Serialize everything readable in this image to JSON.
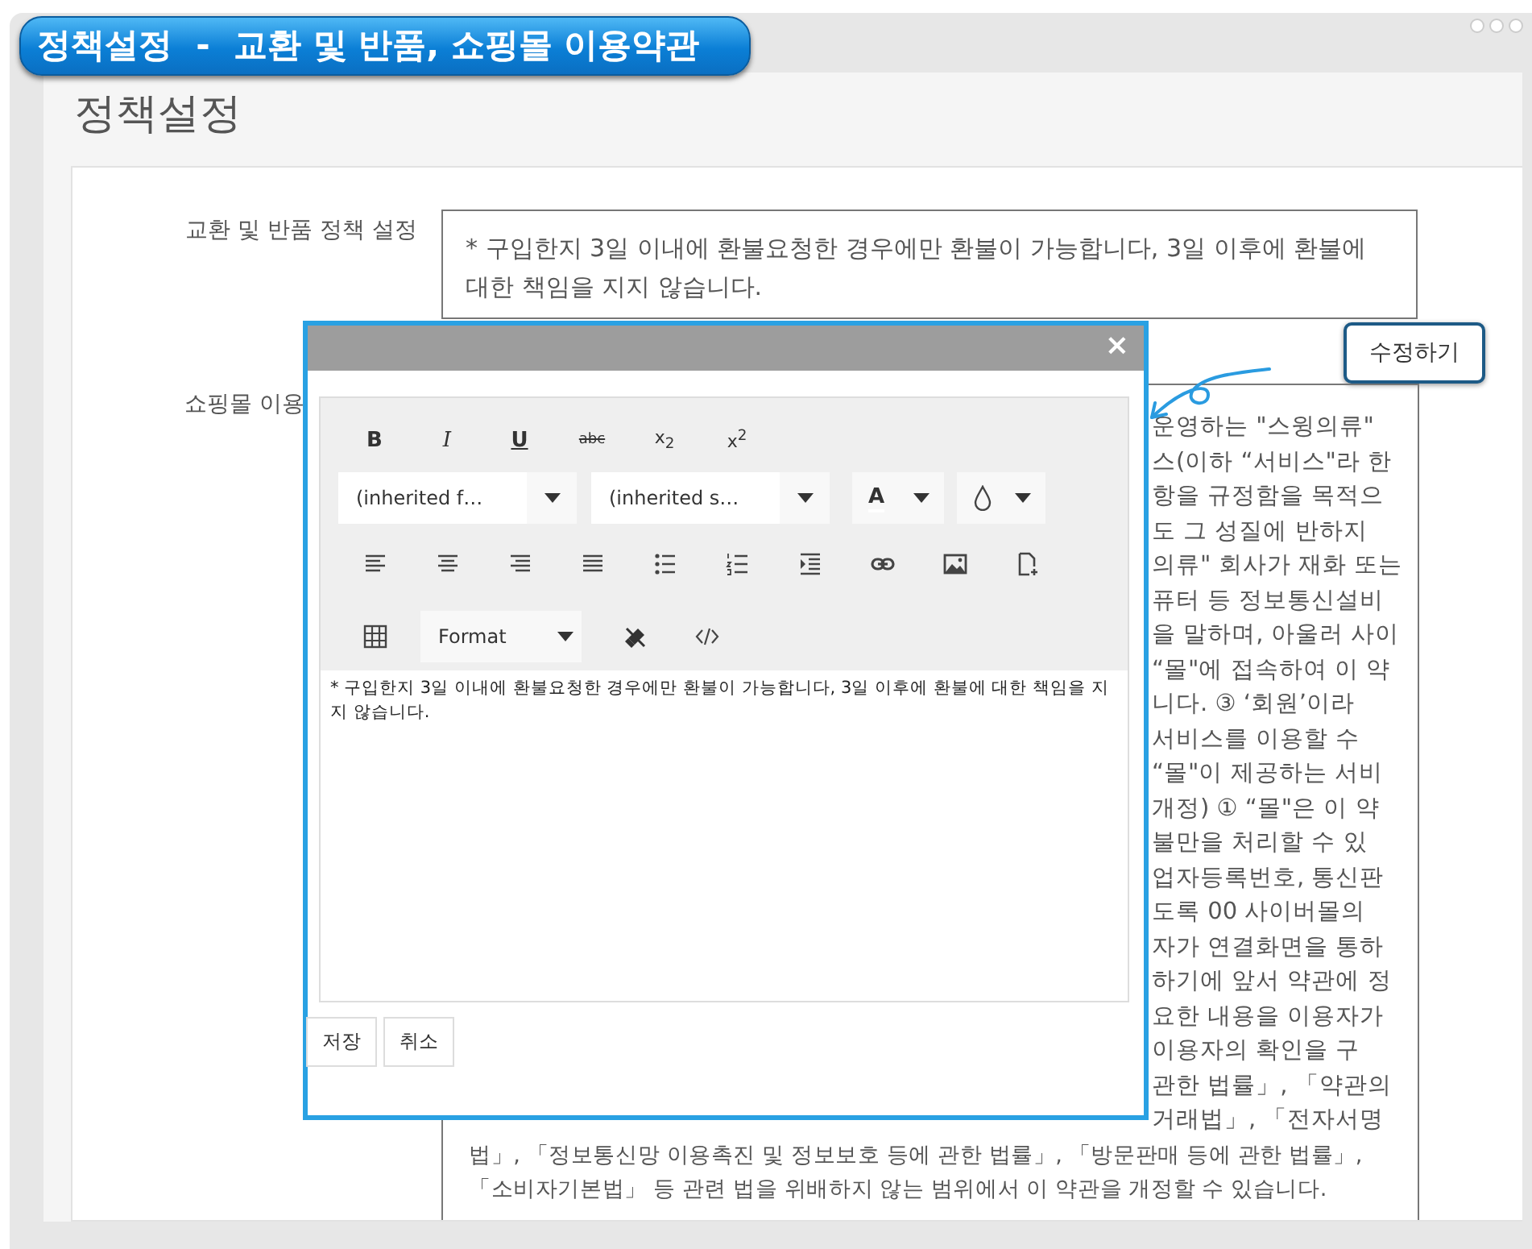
{
  "badge": {
    "title": "정책설정  -  교환 및 반품, 쇼핑몰 이용약관"
  },
  "page": {
    "heading": "정책설정"
  },
  "form": {
    "exchange_policy": {
      "label": "교환 및 반품 정책 설정",
      "value": "* 구입한지 3일 이내에 환불요청한 경우에만 환불이 가능합니다, 3일 이후에 환불에 대한 책임을 지지 않습니다."
    },
    "edit_button": "수정하기",
    "terms": {
      "label": "쇼핑몰 이용",
      "partial_lines": [
        "운영하는 \"스윙의류\"",
        "스(이하 “서비스\"라 한",
        "항을 규정함을 목적으",
        "도 그 성질에 반하지",
        "의류\" 회사가 재화 또는",
        "퓨터 등 정보통신설비",
        "을 말하며, 아울러 사이",
        "“몰\"에 접속하여 이 약",
        "니다. ③ ‘회원’이라",
        "서비스를 이용할 수",
        "“몰\"이 제공하는 서비",
        "개정) ① “몰\"은 이 약",
        "불만을 처리할 수 있",
        "업자등록번호, 통신판",
        "도록 00 사이버몰의",
        "자가 연결화면을 통하",
        "하기에 앞서 약관에 정",
        "요한 내용을 이용자가",
        "이용자의 확인을 구",
        "관한 법률」, 「약관의",
        "거래법」, 「전자서명"
      ],
      "lines": [
        "법」, 「정보통신망 이용촉진 및 정보보호 등에 관한 법률」, 「방문판매 등에 관한 법률」,",
        "「소비자기본법」 등 관련 법을 위배하지 않는 범위에서 이 약관을 개정할 수 있습니다."
      ]
    }
  },
  "modal": {
    "close": "×",
    "toolbar": [
      [
        {
          "kind": "bold",
          "label": "B"
        },
        {
          "kind": "italic",
          "label": "I"
        },
        {
          "kind": "underline",
          "label": "U"
        },
        {
          "kind": "strike",
          "label": "abc"
        },
        {
          "kind": "subscript",
          "label": "x$_{2}$"
        },
        {
          "kind": "superscript",
          "label": "x$^{2}$"
        }
      ],
      [
        {
          "kind": "select",
          "label": "(inherited f…"
        },
        {
          "kind": "select",
          "label": "(inherited s…"
        },
        {
          "kind": "color",
          "label": "A"
        },
        {
          "kind": "bgcolor"
        }
      ],
      [
        {
          "kind": "align-left"
        },
        {
          "kind": "align-center"
        },
        {
          "kind": "align-right"
        },
        {
          "kind": "justify"
        },
        {
          "kind": "bullet-list"
        },
        {
          "kind": "numbered-list"
        },
        {
          "kind": "indent"
        },
        {
          "kind": "link"
        },
        {
          "kind": "image"
        },
        {
          "kind": "add-file"
        }
      ],
      [
        {
          "kind": "table"
        },
        {
          "kind": "format",
          "label": "Format"
        },
        {
          "kind": "eraser"
        },
        {
          "kind": "code"
        }
      ]
    ],
    "content": "* 구입한지 3일 이내에 환불요청한 경우에만 환불이 가능합니다, 3일 이후에 환불에 대한 책임을 지지 않습니다.",
    "buttons": [
      "저장",
      "취소"
    ]
  }
}
